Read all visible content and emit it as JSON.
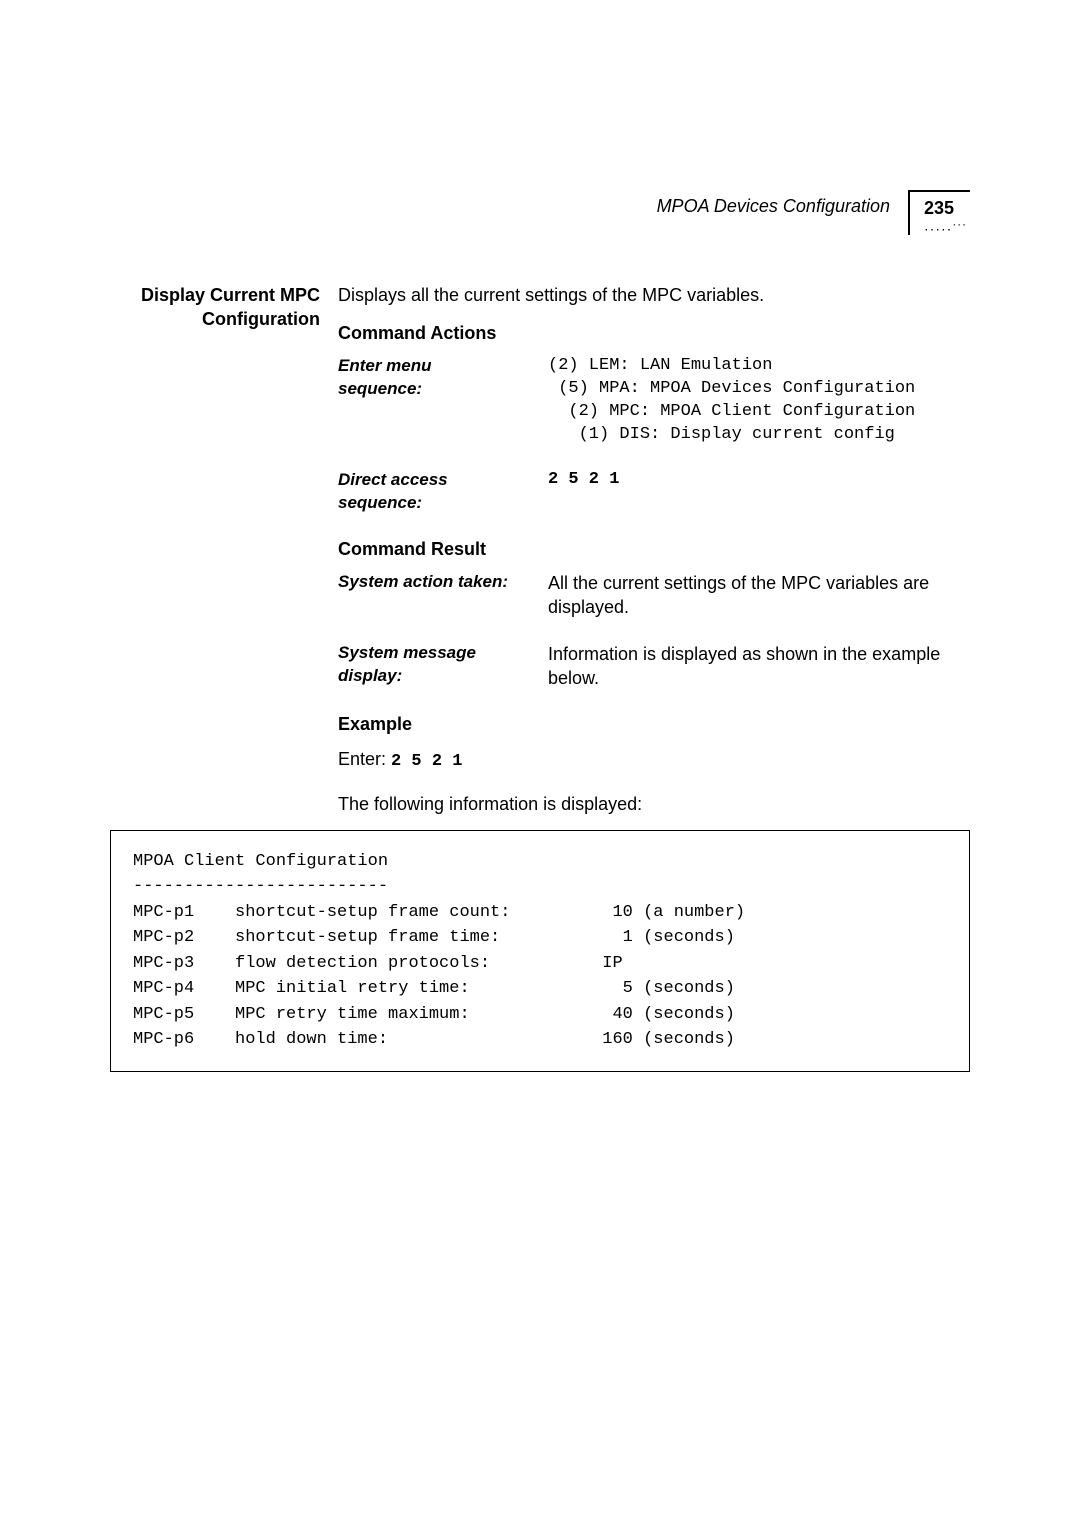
{
  "header": {
    "section": "MPOA Devices Configuration",
    "page_number": "235"
  },
  "side_heading": "Display Current MPC Configuration",
  "intro": "Displays all the current settings of the MPC variables.",
  "command_actions": {
    "title": "Command Actions",
    "enter_menu": {
      "label": "Enter menu sequence:",
      "lines": "(2) LEM: LAN Emulation\n (5) MPA: MPOA Devices Configuration\n  (2) MPC: MPOA Client Configuration\n   (1) DIS: Display current config"
    },
    "direct_access": {
      "label": "Direct access sequence:",
      "value": "2 5 2 1"
    }
  },
  "command_result": {
    "title": "Command Result",
    "system_action": {
      "label": "System action taken:",
      "text": "All the current settings of the MPC variables are displayed."
    },
    "system_message": {
      "label": "System message display:",
      "text": "Information is displayed as shown in the example below."
    }
  },
  "example": {
    "title": "Example",
    "enter_prefix": "Enter: ",
    "enter_value": "2 5 2 1",
    "following": "The following information is displayed:",
    "output": "MPOA Client Configuration\n-------------------------\nMPC-p1    shortcut-setup frame count:          10 (a number)\nMPC-p2    shortcut-setup frame time:            1 (seconds)\nMPC-p3    flow detection protocols:           IP\nMPC-p4    MPC initial retry time:               5 (seconds)\nMPC-p5    MPC retry time maximum:              40 (seconds)\nMPC-p6    hold down time:                     160 (seconds)"
  }
}
